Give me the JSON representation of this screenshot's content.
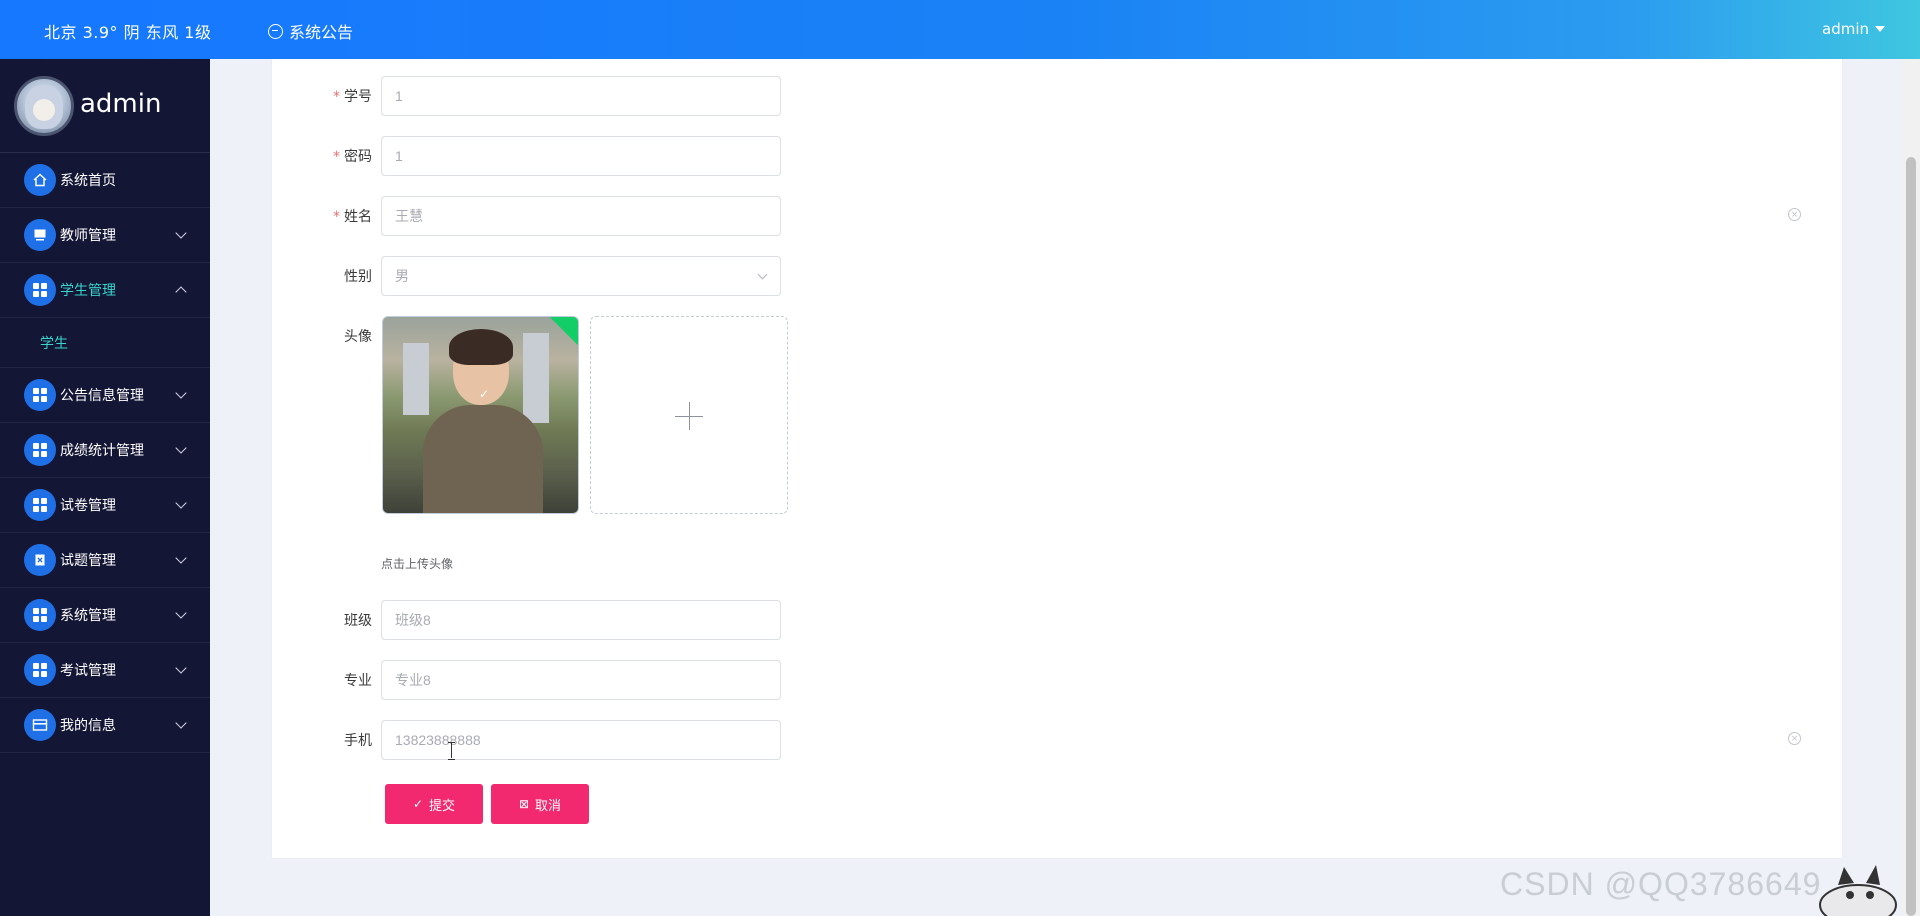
{
  "topbar": {
    "weather": "北京  3.9°  阴  东风  1级",
    "notice_label": "系统公告",
    "user_label": "admin"
  },
  "sidebar": {
    "profile_name": "admin",
    "items": [
      {
        "label": "系统首页",
        "icon": "home-icon"
      },
      {
        "label": "教师管理",
        "icon": "monitor-icon"
      },
      {
        "label": "学生管理",
        "icon": "grid-icon",
        "expanded": true
      },
      {
        "label": "公告信息管理",
        "icon": "grid-icon"
      },
      {
        "label": "成绩统计管理",
        "icon": "grid-icon"
      },
      {
        "label": "试卷管理",
        "icon": "grid-icon"
      },
      {
        "label": "试题管理",
        "icon": "clipboard-icon"
      },
      {
        "label": "系统管理",
        "icon": "grid-icon"
      },
      {
        "label": "考试管理",
        "icon": "grid-icon"
      },
      {
        "label": "我的信息",
        "icon": "card-icon"
      }
    ],
    "sub_items": [
      {
        "label": "学生"
      }
    ]
  },
  "form": {
    "student_id": {
      "label": "学号",
      "required": "*",
      "value": "1"
    },
    "password": {
      "label": "密码",
      "required": "*",
      "value": "1"
    },
    "name": {
      "label": "姓名",
      "required": "*",
      "value": "王慧"
    },
    "gender": {
      "label": "性别",
      "value": "男"
    },
    "avatar": {
      "label": "头像",
      "hint": "点击上传头像"
    },
    "class": {
      "label": "班级",
      "value": "班级8"
    },
    "major": {
      "label": "专业",
      "value": "专业8"
    },
    "phone": {
      "label": "手机",
      "value": "13823888888"
    },
    "submit_label": "提交",
    "cancel_label": "取消"
  },
  "watermark": "CSDN @QQ3786649"
}
